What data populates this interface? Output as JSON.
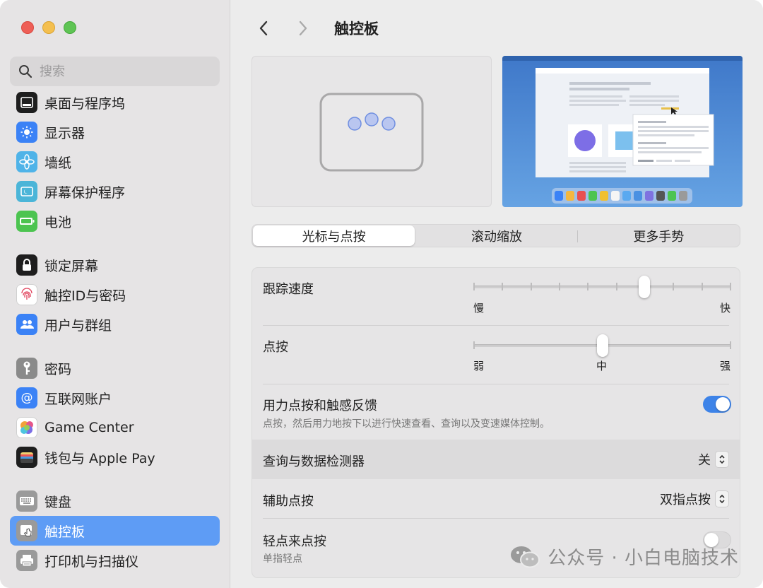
{
  "window": {
    "title": "触控板"
  },
  "search": {
    "placeholder": "搜索"
  },
  "sidebar": {
    "items": [
      {
        "label": "桌面与程序坞",
        "icon": "dock-icon",
        "color": "#1e1e1e"
      },
      {
        "label": "显示器",
        "icon": "sun-icon",
        "color": "#3b82f6"
      },
      {
        "label": "墙纸",
        "icon": "flower-icon",
        "color": "#4fb3e8"
      },
      {
        "label": "屏幕保护程序",
        "icon": "screensaver-icon",
        "color": "#4bb5d8"
      },
      {
        "label": "电池",
        "icon": "battery-icon",
        "color": "#4cc450"
      },
      {
        "label": "锁定屏幕",
        "icon": "lock-icon",
        "color": "#1e1e1e"
      },
      {
        "label": "触控ID与密码",
        "icon": "fingerprint-icon",
        "color": "#ffffff"
      },
      {
        "label": "用户与群组",
        "icon": "users-icon",
        "color": "#3b82f6"
      },
      {
        "label": "密码",
        "icon": "key-icon",
        "color": "#8a8a8a"
      },
      {
        "label": "互联网账户",
        "icon": "at-icon",
        "color": "#3b82f6"
      },
      {
        "label": "Game Center",
        "icon": "game-center-icon",
        "color": "#ffffff"
      },
      {
        "label": "钱包与 Apple Pay",
        "icon": "wallet-icon",
        "color": "#1e1e1e"
      },
      {
        "label": "键盘",
        "icon": "keyboard-icon",
        "color": "#9a9a9a"
      },
      {
        "label": "触控板",
        "icon": "trackpad-icon",
        "color": "#9a9a9a"
      },
      {
        "label": "打印机与扫描仪",
        "icon": "printer-icon",
        "color": "#9a9a9a"
      }
    ],
    "active_index": 13
  },
  "tabs": [
    {
      "label": "光标与点按",
      "active": true
    },
    {
      "label": "滚动缩放",
      "active": false
    },
    {
      "label": "更多手势",
      "active": false
    }
  ],
  "settings": {
    "tracking_speed": {
      "label": "跟踪速度",
      "min_label": "慢",
      "max_label": "快",
      "ticks": 10,
      "value_fraction": 0.664
    },
    "click": {
      "label": "点按",
      "min_label": "弱",
      "mid_label": "中",
      "max_label": "强",
      "ticks": 3,
      "value_fraction": 0.5
    },
    "force_click": {
      "label": "用力点按和触感反馈",
      "description": "点按，然后用力地按下以进行快速查看、查询以及变速媒体控制。",
      "enabled": true
    },
    "lookup": {
      "label": "查询与数据检测器",
      "value": "关"
    },
    "secondary_click": {
      "label": "辅助点按",
      "value": "双指点按"
    },
    "tap_to_click": {
      "label": "轻点来点按",
      "description": "单指轻点",
      "enabled": false
    }
  },
  "watermark": {
    "text": "公众号 · 小白电脑技术"
  },
  "colors": {
    "accent": "#3d83e8",
    "sidebar_active": "#5e9cf5"
  }
}
